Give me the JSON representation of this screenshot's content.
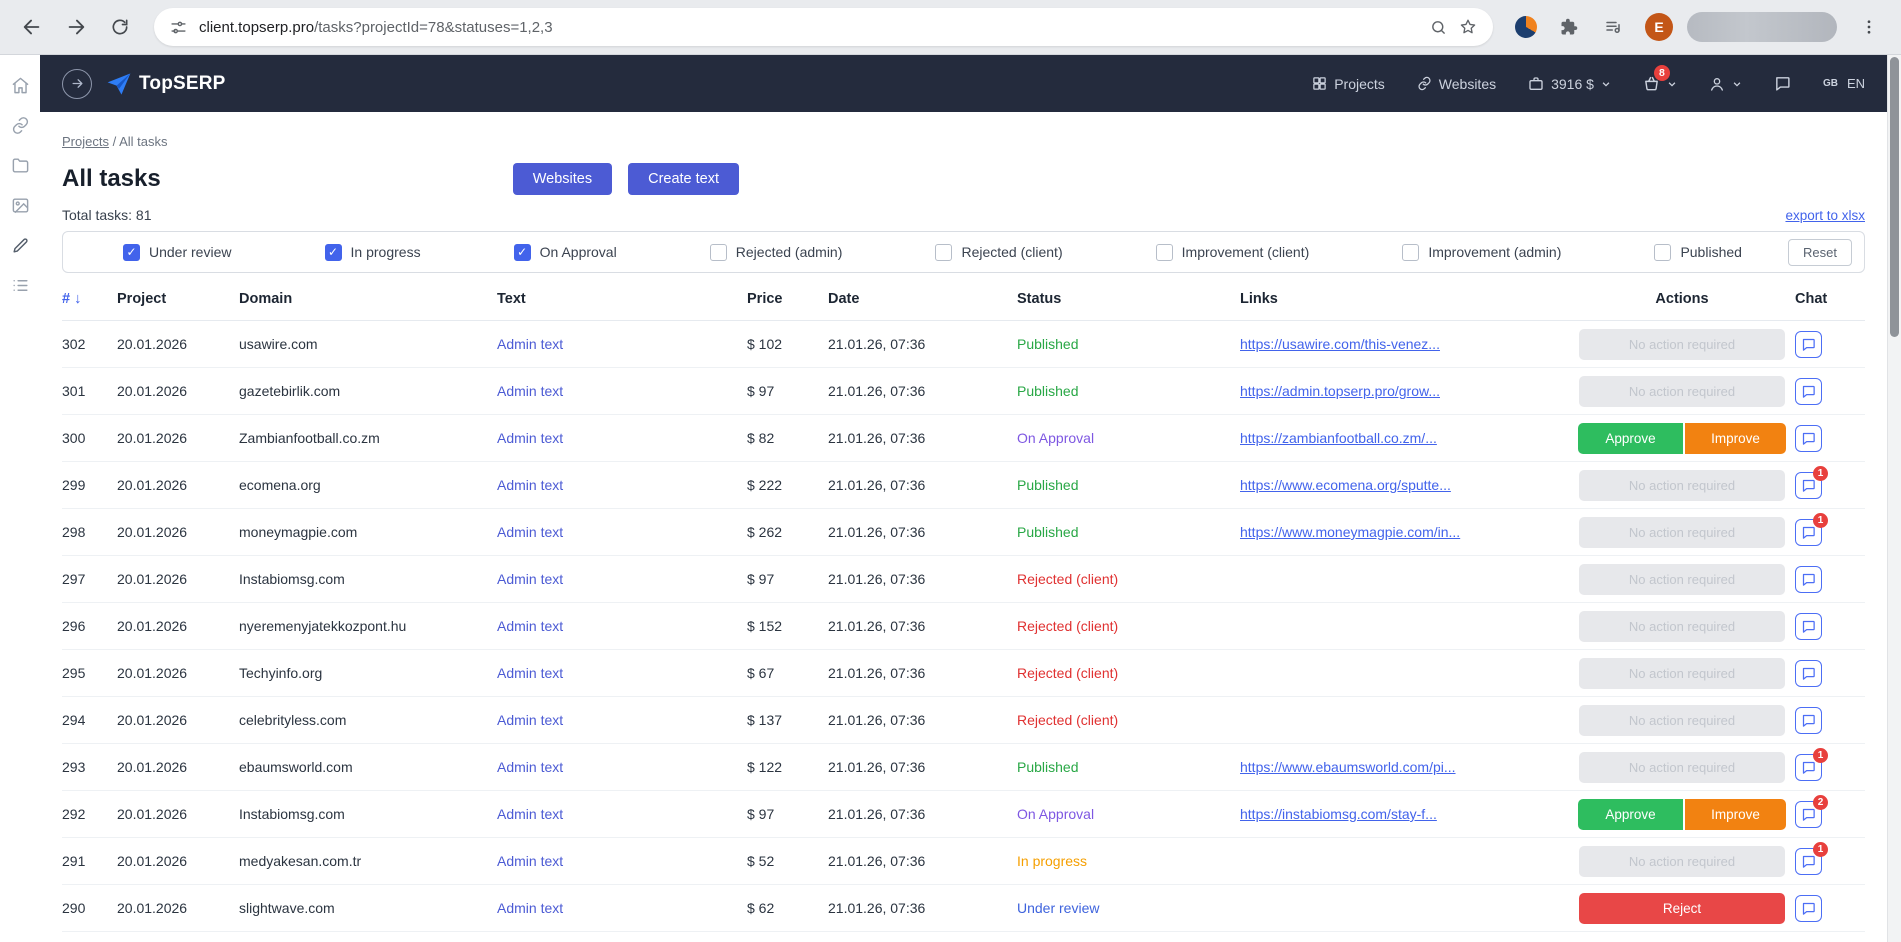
{
  "browser": {
    "url_host": "client.topserp.pro",
    "url_path": "/tasks?projectId=78&statuses=1,2,3",
    "profile_initial": "E"
  },
  "header": {
    "brand": "TopSERP",
    "nav_projects": "Projects",
    "nav_websites": "Websites",
    "balance": "3916 $",
    "cart_badge": "8",
    "lang_region": "GB",
    "lang_code": "EN"
  },
  "breadcrumb": {
    "root": "Projects",
    "separator": "/",
    "current": "All tasks"
  },
  "page": {
    "title": "All tasks",
    "total_tasks": "Total tasks: 81",
    "websites_button": "Websites",
    "create_text_button": "Create text",
    "export_link": "export to xlsx",
    "reset_button": "Reset"
  },
  "filters": [
    {
      "label": "Under review",
      "checked": true
    },
    {
      "label": "In progress",
      "checked": true
    },
    {
      "label": "On Approval",
      "checked": true
    },
    {
      "label": "Rejected (admin)",
      "checked": false
    },
    {
      "label": "Rejected (client)",
      "checked": false
    },
    {
      "label": "Improvement (client)",
      "checked": false
    },
    {
      "label": "Improvement (admin)",
      "checked": false
    },
    {
      "label": "Published",
      "checked": false
    }
  ],
  "colors": {
    "accent": "#4c5bd4",
    "approve": "#2ebd5f",
    "improve": "#f28211",
    "reject": "#e84747",
    "header_bg": "#242b3d"
  },
  "status_colors": {
    "published": "#28a745",
    "on_approval": "#7e57e2",
    "rejected_client": "#e03131",
    "in_progress": "#f59f00",
    "under_review": "#3e63dd"
  },
  "table": {
    "headers": [
      "#",
      "Project",
      "Domain",
      "Text",
      "Price",
      "Date",
      "Status",
      "Links",
      "Actions",
      "Chat"
    ],
    "sort_arrow": "↓",
    "action_labels": {
      "none": "No action required",
      "approve": "Approve",
      "improve": "Improve",
      "reject": "Reject"
    },
    "rows": [
      {
        "id": "302",
        "project": "20.01.2026",
        "domain": "usawire.com",
        "text": "Admin text",
        "price": "$ 102",
        "date": "21.01.26, 07:36",
        "status": "Published",
        "status_type": "published",
        "link": "https://usawire.com/this-venez...",
        "actions": "none",
        "chat_badge": 0
      },
      {
        "id": "301",
        "project": "20.01.2026",
        "domain": "gazetebirlik.com",
        "text": "Admin text",
        "price": "$ 97",
        "date": "21.01.26, 07:36",
        "status": "Published",
        "status_type": "published",
        "link": "https://admin.topserp.pro/grow...",
        "actions": "none",
        "chat_badge": 0
      },
      {
        "id": "300",
        "project": "20.01.2026",
        "domain": "Zambianfootball.co.zm",
        "text": "Admin text",
        "price": "$ 82",
        "date": "21.01.26, 07:36",
        "status": "On Approval",
        "status_type": "on_approval",
        "link": "https://zambianfootball.co.zm/...",
        "actions": "approve",
        "chat_badge": 0
      },
      {
        "id": "299",
        "project": "20.01.2026",
        "domain": "ecomena.org",
        "text": "Admin text",
        "price": "$ 222",
        "date": "21.01.26, 07:36",
        "status": "Published",
        "status_type": "published",
        "link": "https://www.ecomena.org/sputte...",
        "actions": "none",
        "chat_badge": 1
      },
      {
        "id": "298",
        "project": "20.01.2026",
        "domain": "moneymagpie.com",
        "text": "Admin text",
        "price": "$ 262",
        "date": "21.01.26, 07:36",
        "status": "Published",
        "status_type": "published",
        "link": "https://www.moneymagpie.com/in...",
        "actions": "none",
        "chat_badge": 1
      },
      {
        "id": "297",
        "project": "20.01.2026",
        "domain": "Instabiomsg.com",
        "text": "Admin text",
        "price": "$ 97",
        "date": "21.01.26, 07:36",
        "status": "Rejected (client)",
        "status_type": "rejected_client",
        "link": "",
        "actions": "none",
        "chat_badge": 0
      },
      {
        "id": "296",
        "project": "20.01.2026",
        "domain": "nyeremenyjatekkozpont.hu",
        "text": "Admin text",
        "price": "$ 152",
        "date": "21.01.26, 07:36",
        "status": "Rejected (client)",
        "status_type": "rejected_client",
        "link": "",
        "actions": "none",
        "chat_badge": 0
      },
      {
        "id": "295",
        "project": "20.01.2026",
        "domain": "Techyinfo.org",
        "text": "Admin text",
        "price": "$ 67",
        "date": "21.01.26, 07:36",
        "status": "Rejected (client)",
        "status_type": "rejected_client",
        "link": "",
        "actions": "none",
        "chat_badge": 0
      },
      {
        "id": "294",
        "project": "20.01.2026",
        "domain": "celebrityless.com",
        "text": "Admin text",
        "price": "$ 137",
        "date": "21.01.26, 07:36",
        "status": "Rejected (client)",
        "status_type": "rejected_client",
        "link": "",
        "actions": "none",
        "chat_badge": 0
      },
      {
        "id": "293",
        "project": "20.01.2026",
        "domain": "ebaumsworld.com",
        "text": "Admin text",
        "price": "$ 122",
        "date": "21.01.26, 07:36",
        "status": "Published",
        "status_type": "published",
        "link": "https://www.ebaumsworld.com/pi...",
        "actions": "none",
        "chat_badge": 1
      },
      {
        "id": "292",
        "project": "20.01.2026",
        "domain": "Instabiomsg.com",
        "text": "Admin text",
        "price": "$ 97",
        "date": "21.01.26, 07:36",
        "status": "On Approval",
        "status_type": "on_approval",
        "link": "https://instabiomsg.com/stay-f...",
        "actions": "approve",
        "chat_badge": 2
      },
      {
        "id": "291",
        "project": "20.01.2026",
        "domain": "medyakesan.com.tr",
        "text": "Admin text",
        "price": "$ 52",
        "date": "21.01.26, 07:36",
        "status": "In progress",
        "status_type": "in_progress",
        "link": "",
        "actions": "none",
        "chat_badge": 1
      },
      {
        "id": "290",
        "project": "20.01.2026",
        "domain": "slightwave.com",
        "text": "Admin text",
        "price": "$ 62",
        "date": "21.01.26, 07:36",
        "status": "Under review",
        "status_type": "under_review",
        "link": "",
        "actions": "reject",
        "chat_badge": 0
      }
    ]
  }
}
